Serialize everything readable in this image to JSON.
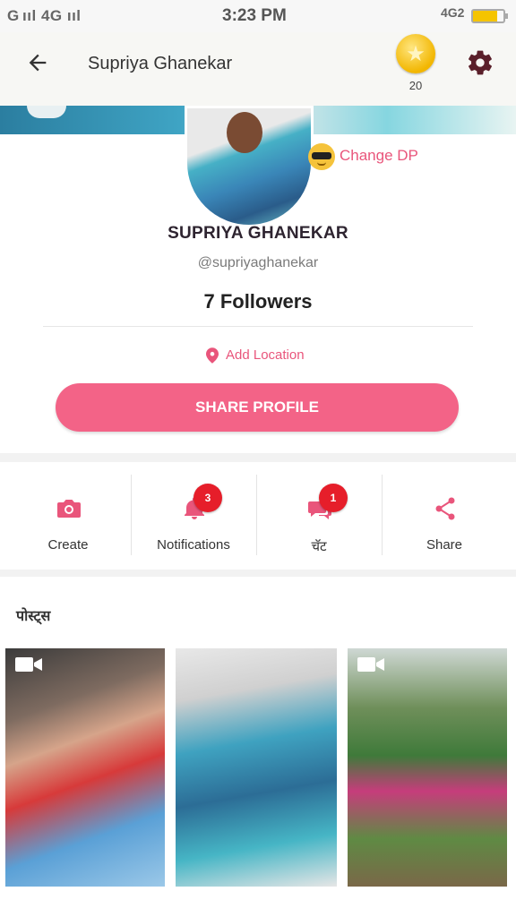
{
  "status_bar": {
    "signal": "G ııl 4G ııl",
    "time": "3:23 PM",
    "network": "4G2"
  },
  "header": {
    "title": "Supriya Ghanekar",
    "coins": "20"
  },
  "profile": {
    "change_dp": "Change DP",
    "name": "SUPRIYA GHANEKAR",
    "handle": "@supriyaghanekar",
    "followers": "7 Followers",
    "add_location": "Add Location",
    "share_profile": "SHARE PROFILE"
  },
  "actions": [
    {
      "label": "Create",
      "icon": "camera-icon"
    },
    {
      "label": "Notifications",
      "icon": "bell-icon",
      "badge": "3"
    },
    {
      "label": "चॅट",
      "icon": "chat-icon",
      "badge": "1"
    },
    {
      "label": "Share",
      "icon": "share-icon"
    }
  ],
  "posts": {
    "title": "पोस्ट्स",
    "items": [
      {
        "type": "video"
      },
      {
        "type": "image"
      },
      {
        "type": "video"
      }
    ]
  },
  "colors": {
    "accent": "#f36387",
    "badge": "#e61e2a",
    "icon": "#e9557b"
  }
}
